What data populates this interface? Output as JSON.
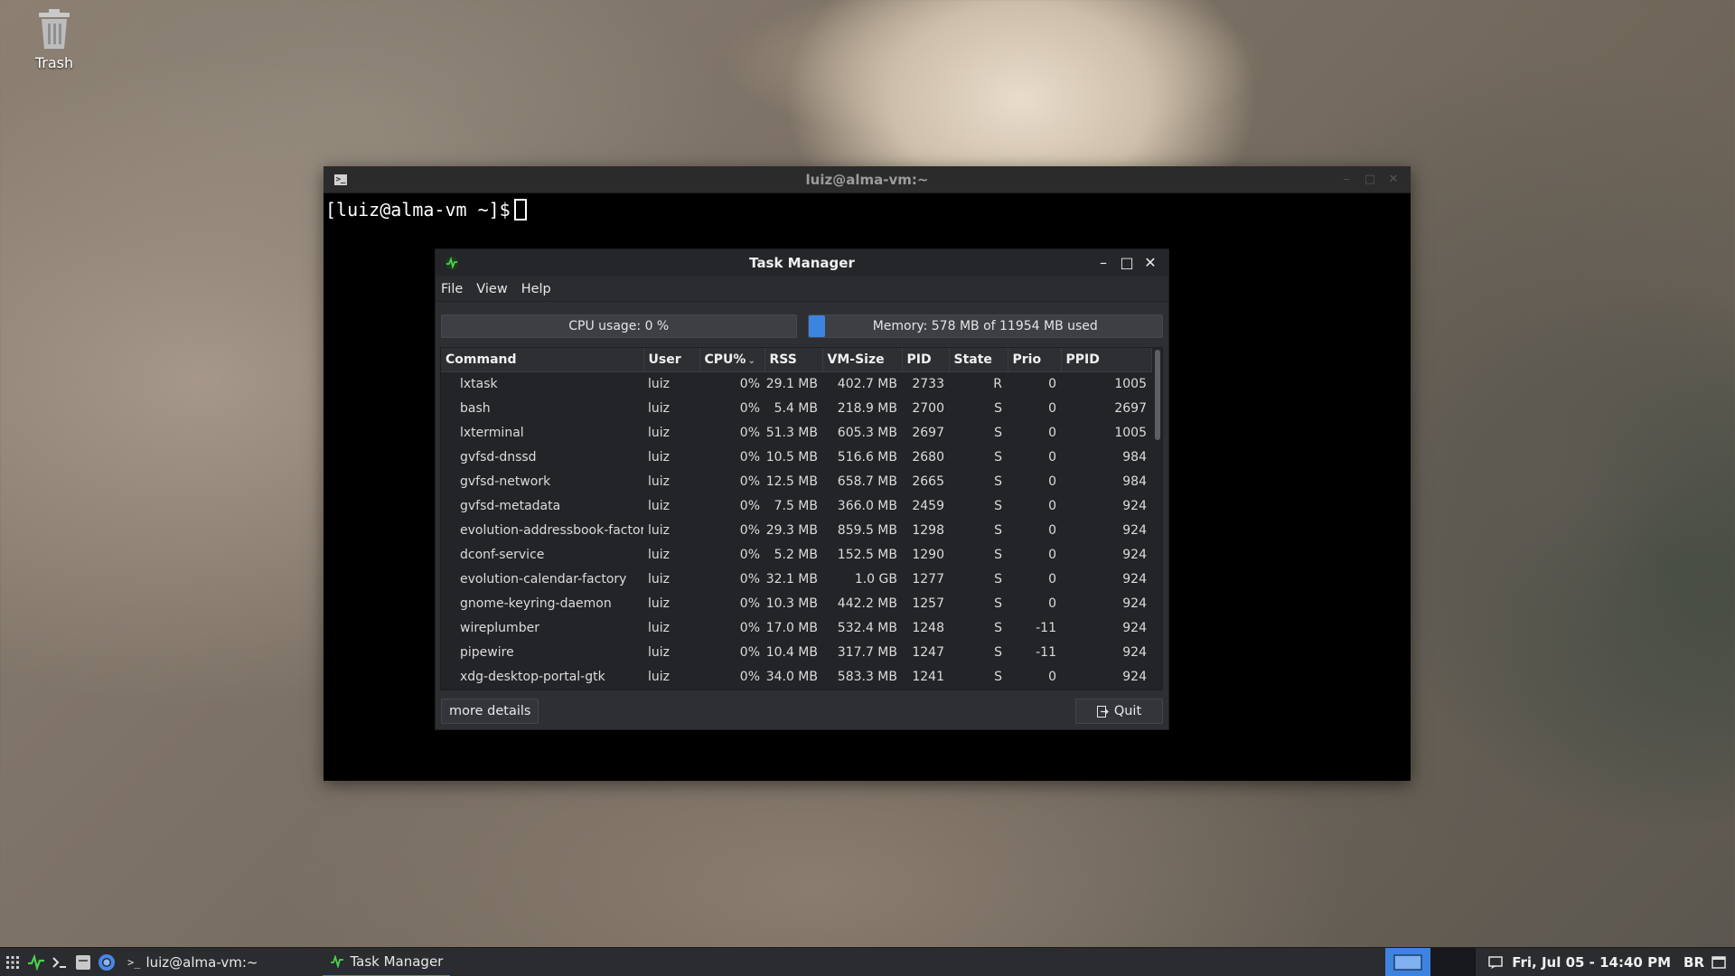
{
  "desktop": {
    "trash_label": "Trash"
  },
  "terminal": {
    "title": "luiz@alma-vm:~",
    "prompt": "[luiz@alma-vm ~]$"
  },
  "task_manager": {
    "title": "Task Manager",
    "menu": [
      "File",
      "View",
      "Help"
    ],
    "cpu_usage_text": "CPU usage: 0 %",
    "cpu_usage_fraction": 0.0,
    "memory_text": "Memory: 578 MB of 11954 MB used",
    "memory_used_mb": 578,
    "memory_total_mb": 11954,
    "columns": [
      "Command",
      "User",
      "CPU%",
      "RSS",
      "VM-Size",
      "PID",
      "State",
      "Prio",
      "PPID"
    ],
    "sorted_column": "CPU%",
    "processes": [
      {
        "command": "lxtask",
        "user": "luiz",
        "cpu": "0%",
        "rss": "29.1 MB",
        "vm": "402.7 MB",
        "pid": "2733",
        "state": "R",
        "prio": "0",
        "ppid": "1005"
      },
      {
        "command": "bash",
        "user": "luiz",
        "cpu": "0%",
        "rss": "5.4 MB",
        "vm": "218.9 MB",
        "pid": "2700",
        "state": "S",
        "prio": "0",
        "ppid": "2697"
      },
      {
        "command": "lxterminal",
        "user": "luiz",
        "cpu": "0%",
        "rss": "51.3 MB",
        "vm": "605.3 MB",
        "pid": "2697",
        "state": "S",
        "prio": "0",
        "ppid": "1005"
      },
      {
        "command": "gvfsd-dnssd",
        "user": "luiz",
        "cpu": "0%",
        "rss": "10.5 MB",
        "vm": "516.6 MB",
        "pid": "2680",
        "state": "S",
        "prio": "0",
        "ppid": "984"
      },
      {
        "command": "gvfsd-network",
        "user": "luiz",
        "cpu": "0%",
        "rss": "12.5 MB",
        "vm": "658.7 MB",
        "pid": "2665",
        "state": "S",
        "prio": "0",
        "ppid": "984"
      },
      {
        "command": "gvfsd-metadata",
        "user": "luiz",
        "cpu": "0%",
        "rss": "7.5 MB",
        "vm": "366.0 MB",
        "pid": "2459",
        "state": "S",
        "prio": "0",
        "ppid": "924"
      },
      {
        "command": "evolution-addressbook-factory",
        "user": "luiz",
        "cpu": "0%",
        "rss": "29.3 MB",
        "vm": "859.5 MB",
        "pid": "1298",
        "state": "S",
        "prio": "0",
        "ppid": "924"
      },
      {
        "command": "dconf-service",
        "user": "luiz",
        "cpu": "0%",
        "rss": "5.2 MB",
        "vm": "152.5 MB",
        "pid": "1290",
        "state": "S",
        "prio": "0",
        "ppid": "924"
      },
      {
        "command": "evolution-calendar-factory",
        "user": "luiz",
        "cpu": "0%",
        "rss": "32.1 MB",
        "vm": "1.0 GB",
        "pid": "1277",
        "state": "S",
        "prio": "0",
        "ppid": "924"
      },
      {
        "command": "gnome-keyring-daemon",
        "user": "luiz",
        "cpu": "0%",
        "rss": "10.3 MB",
        "vm": "442.2 MB",
        "pid": "1257",
        "state": "S",
        "prio": "0",
        "ppid": "924"
      },
      {
        "command": "wireplumber",
        "user": "luiz",
        "cpu": "0%",
        "rss": "17.0 MB",
        "vm": "532.4 MB",
        "pid": "1248",
        "state": "S",
        "prio": "-11",
        "ppid": "924"
      },
      {
        "command": "pipewire",
        "user": "luiz",
        "cpu": "0%",
        "rss": "10.4 MB",
        "vm": "317.7 MB",
        "pid": "1247",
        "state": "S",
        "prio": "-11",
        "ppid": "924"
      },
      {
        "command": "xdg-desktop-portal-gtk",
        "user": "luiz",
        "cpu": "0%",
        "rss": "34.0 MB",
        "vm": "583.3 MB",
        "pid": "1241",
        "state": "S",
        "prio": "0",
        "ppid": "924"
      }
    ],
    "more_details_label": "more details",
    "quit_label": "Quit"
  },
  "taskbar": {
    "tasks": [
      {
        "label": "luiz@alma-vm:~",
        "icon": "terminal-icon"
      },
      {
        "label": "Task Manager",
        "icon": "task-manager-icon",
        "active": true
      }
    ],
    "clock": "Fri, Jul 05 - 14:40 PM",
    "keyboard_layout": "BR",
    "accent_color": "#3d84e0"
  }
}
